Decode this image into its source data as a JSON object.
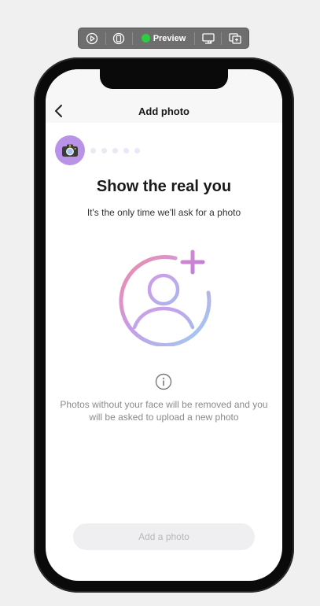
{
  "toolbar": {
    "preview_label": "Preview",
    "icons": [
      "play-icon",
      "device-icon",
      "monitor-icon",
      "add-window-icon"
    ],
    "status_color": "#2ecc40"
  },
  "nav": {
    "title": "Add photo",
    "back_icon": "chevron-left-icon"
  },
  "progress": {
    "active_step_icon": "camera-icon",
    "remaining_steps": 5,
    "accent": "#b993e8"
  },
  "main": {
    "headline": "Show the real you",
    "subtitle": "It's the only time we'll ask for a photo",
    "illustration_icon": "add-profile-photo-icon",
    "info_icon": "info-icon",
    "notice": "Photos without your face will be removed and you will be asked to upload a new photo"
  },
  "cta": {
    "label": "Add a photo",
    "enabled": false
  }
}
